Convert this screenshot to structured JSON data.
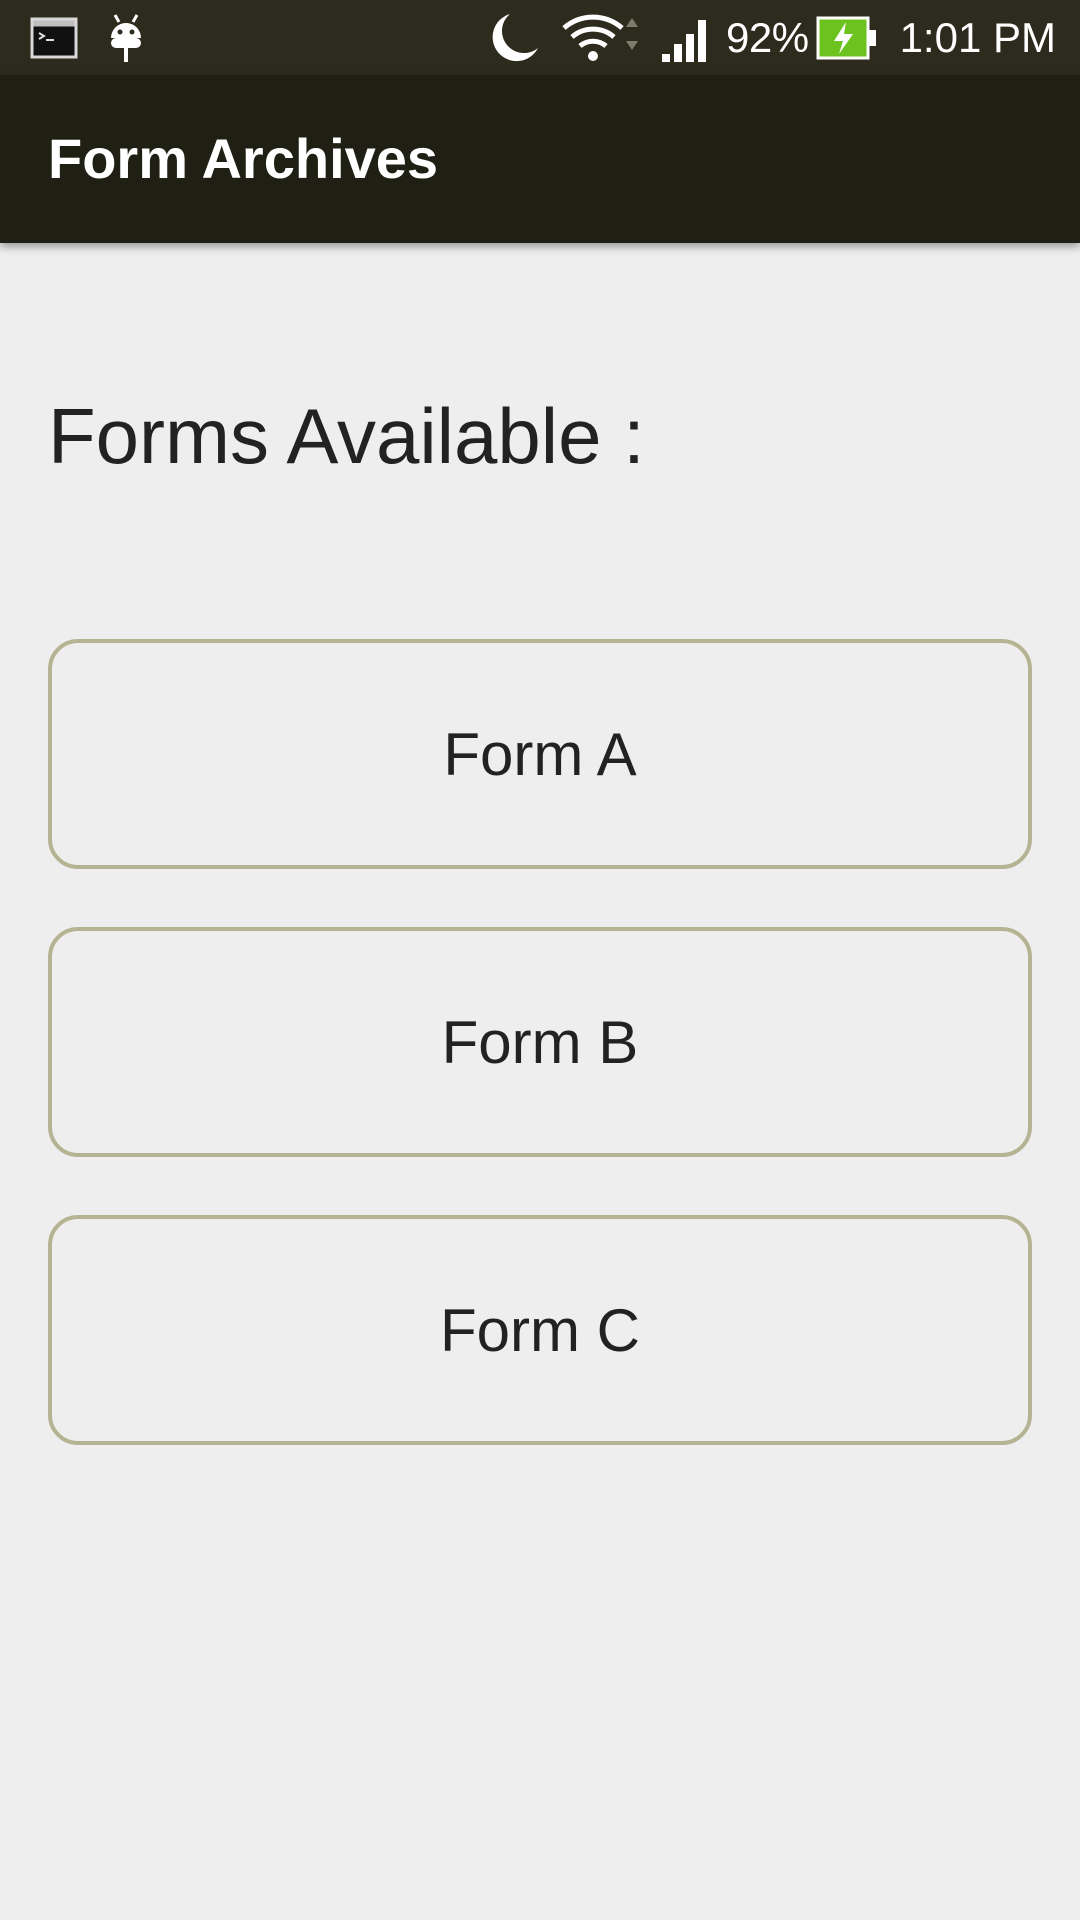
{
  "status_bar": {
    "icons": [
      "terminal-icon",
      "android-debug-icon",
      "do-not-disturb-moon-icon",
      "wifi-icon",
      "cell-signal-icon",
      "battery-charging-icon"
    ],
    "battery_percent": "92%",
    "time": "1:01 PM",
    "battery_color": "#6cc21e"
  },
  "app_bar": {
    "title": "Form Archives",
    "background": "#1f1f14"
  },
  "main": {
    "heading": "Forms Available :",
    "forms": [
      {
        "label": "Form A"
      },
      {
        "label": "Form B"
      },
      {
        "label": "Form C"
      }
    ],
    "button_border_color": "#b5b492"
  }
}
